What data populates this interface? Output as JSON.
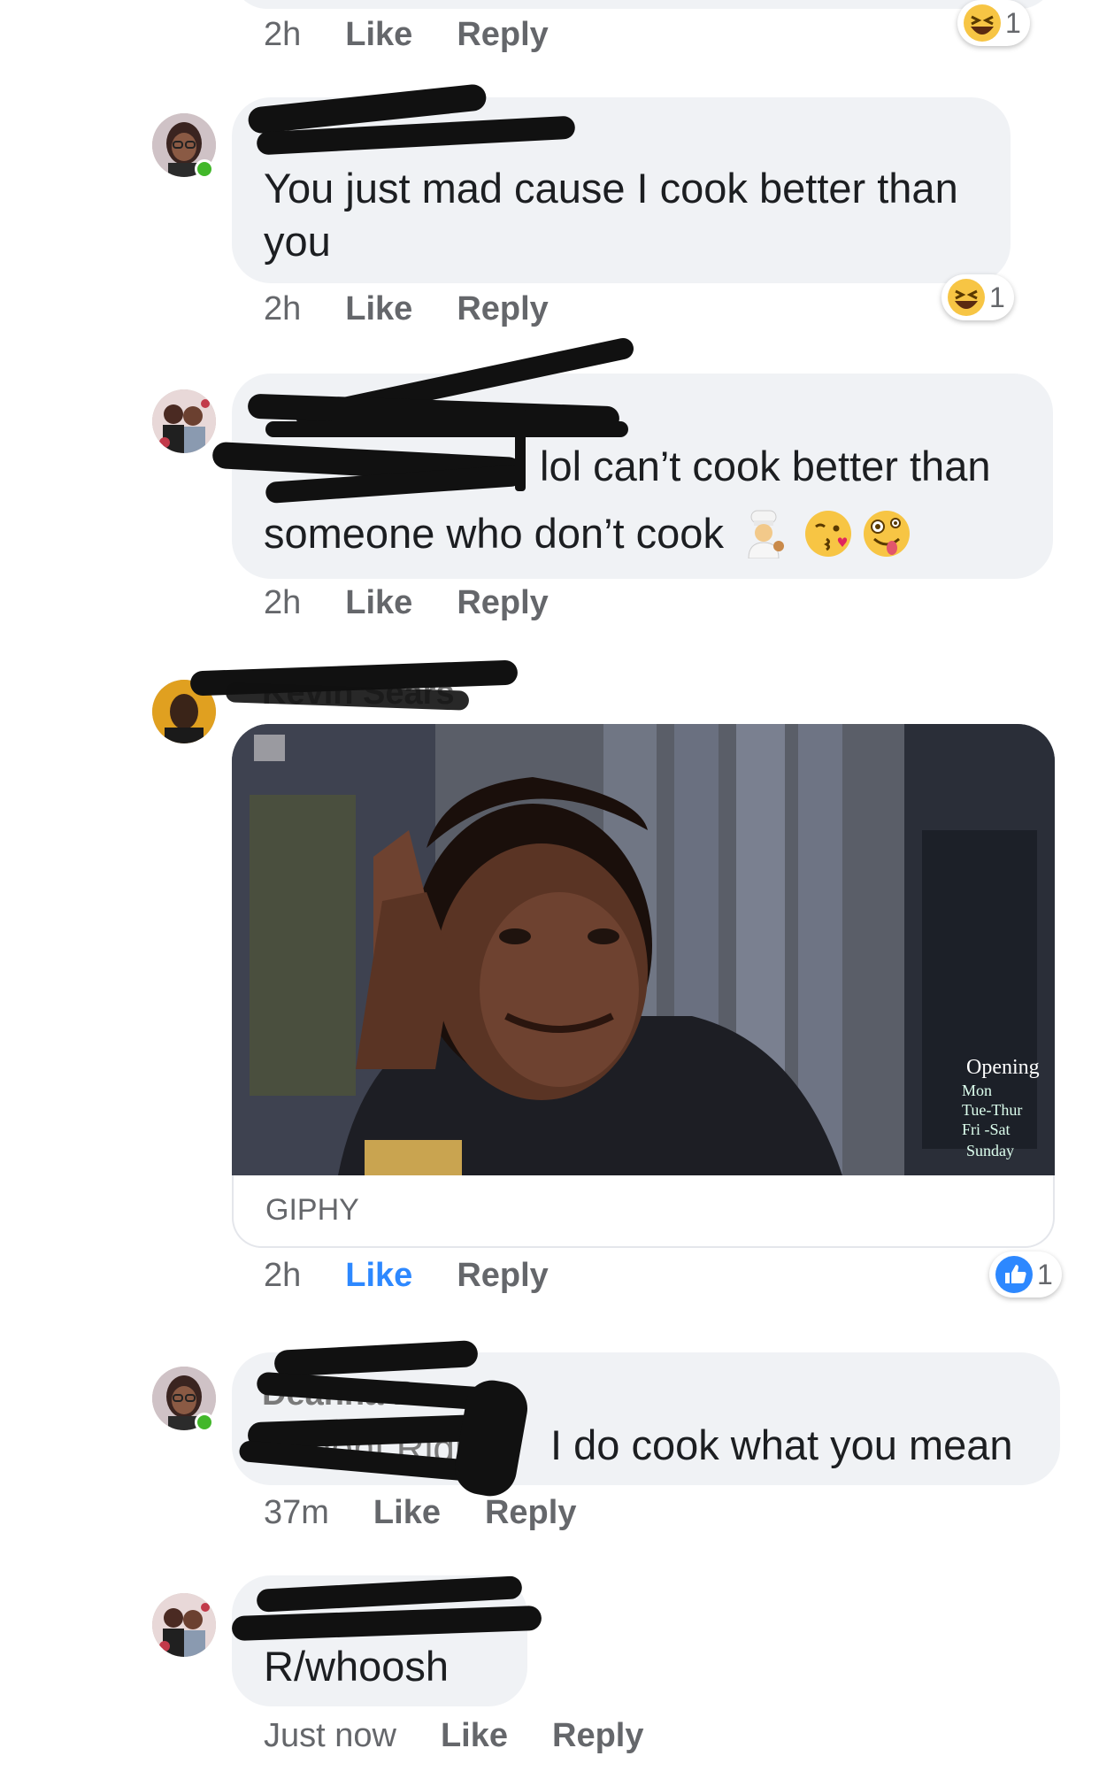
{
  "comments": [
    {
      "time": "2h",
      "like": "Like",
      "reply": "Reply",
      "reaction": {
        "icon": "laugh-emoji-icon",
        "count": "1"
      }
    },
    {
      "text": "You just mad cause I cook better than you",
      "time": "2h",
      "like": "Like",
      "reply": "Reply",
      "reaction": {
        "icon": "laugh-emoji-icon",
        "count": "1"
      }
    },
    {
      "text_line1": "lol can’t cook better than",
      "text_line2": "someone who don’t cook",
      "emojis": [
        "cook-emoji-icon",
        "kiss-emoji-icon",
        "zany-face-emoji-icon"
      ],
      "time": "2h",
      "like": "Like",
      "reply": "Reply"
    },
    {
      "author": "Kevin Sears",
      "gif_source": "GIPHY",
      "gif_sign": [
        "Opening",
        "Mon",
        "Tue-Thur",
        "Fri -Sat",
        "Sunday"
      ],
      "time": "2h",
      "like": "Like",
      "reply": "Reply",
      "reaction": {
        "icon": "thumbs-up-icon",
        "count": "1"
      }
    },
    {
      "author": "Deanna Penn",
      "mention": "A'mont Ridley",
      "text": "I do cook what you mean",
      "time": "37m",
      "like": "Like",
      "reply": "Reply"
    },
    {
      "text": "R/whoosh",
      "time": "Just now",
      "like": "Like",
      "reply": "Reply"
    }
  ],
  "colors": {
    "bubble": "#f0f2f5",
    "meta": "#65676b",
    "liked": "#2d88ff",
    "online": "#42b72a"
  }
}
